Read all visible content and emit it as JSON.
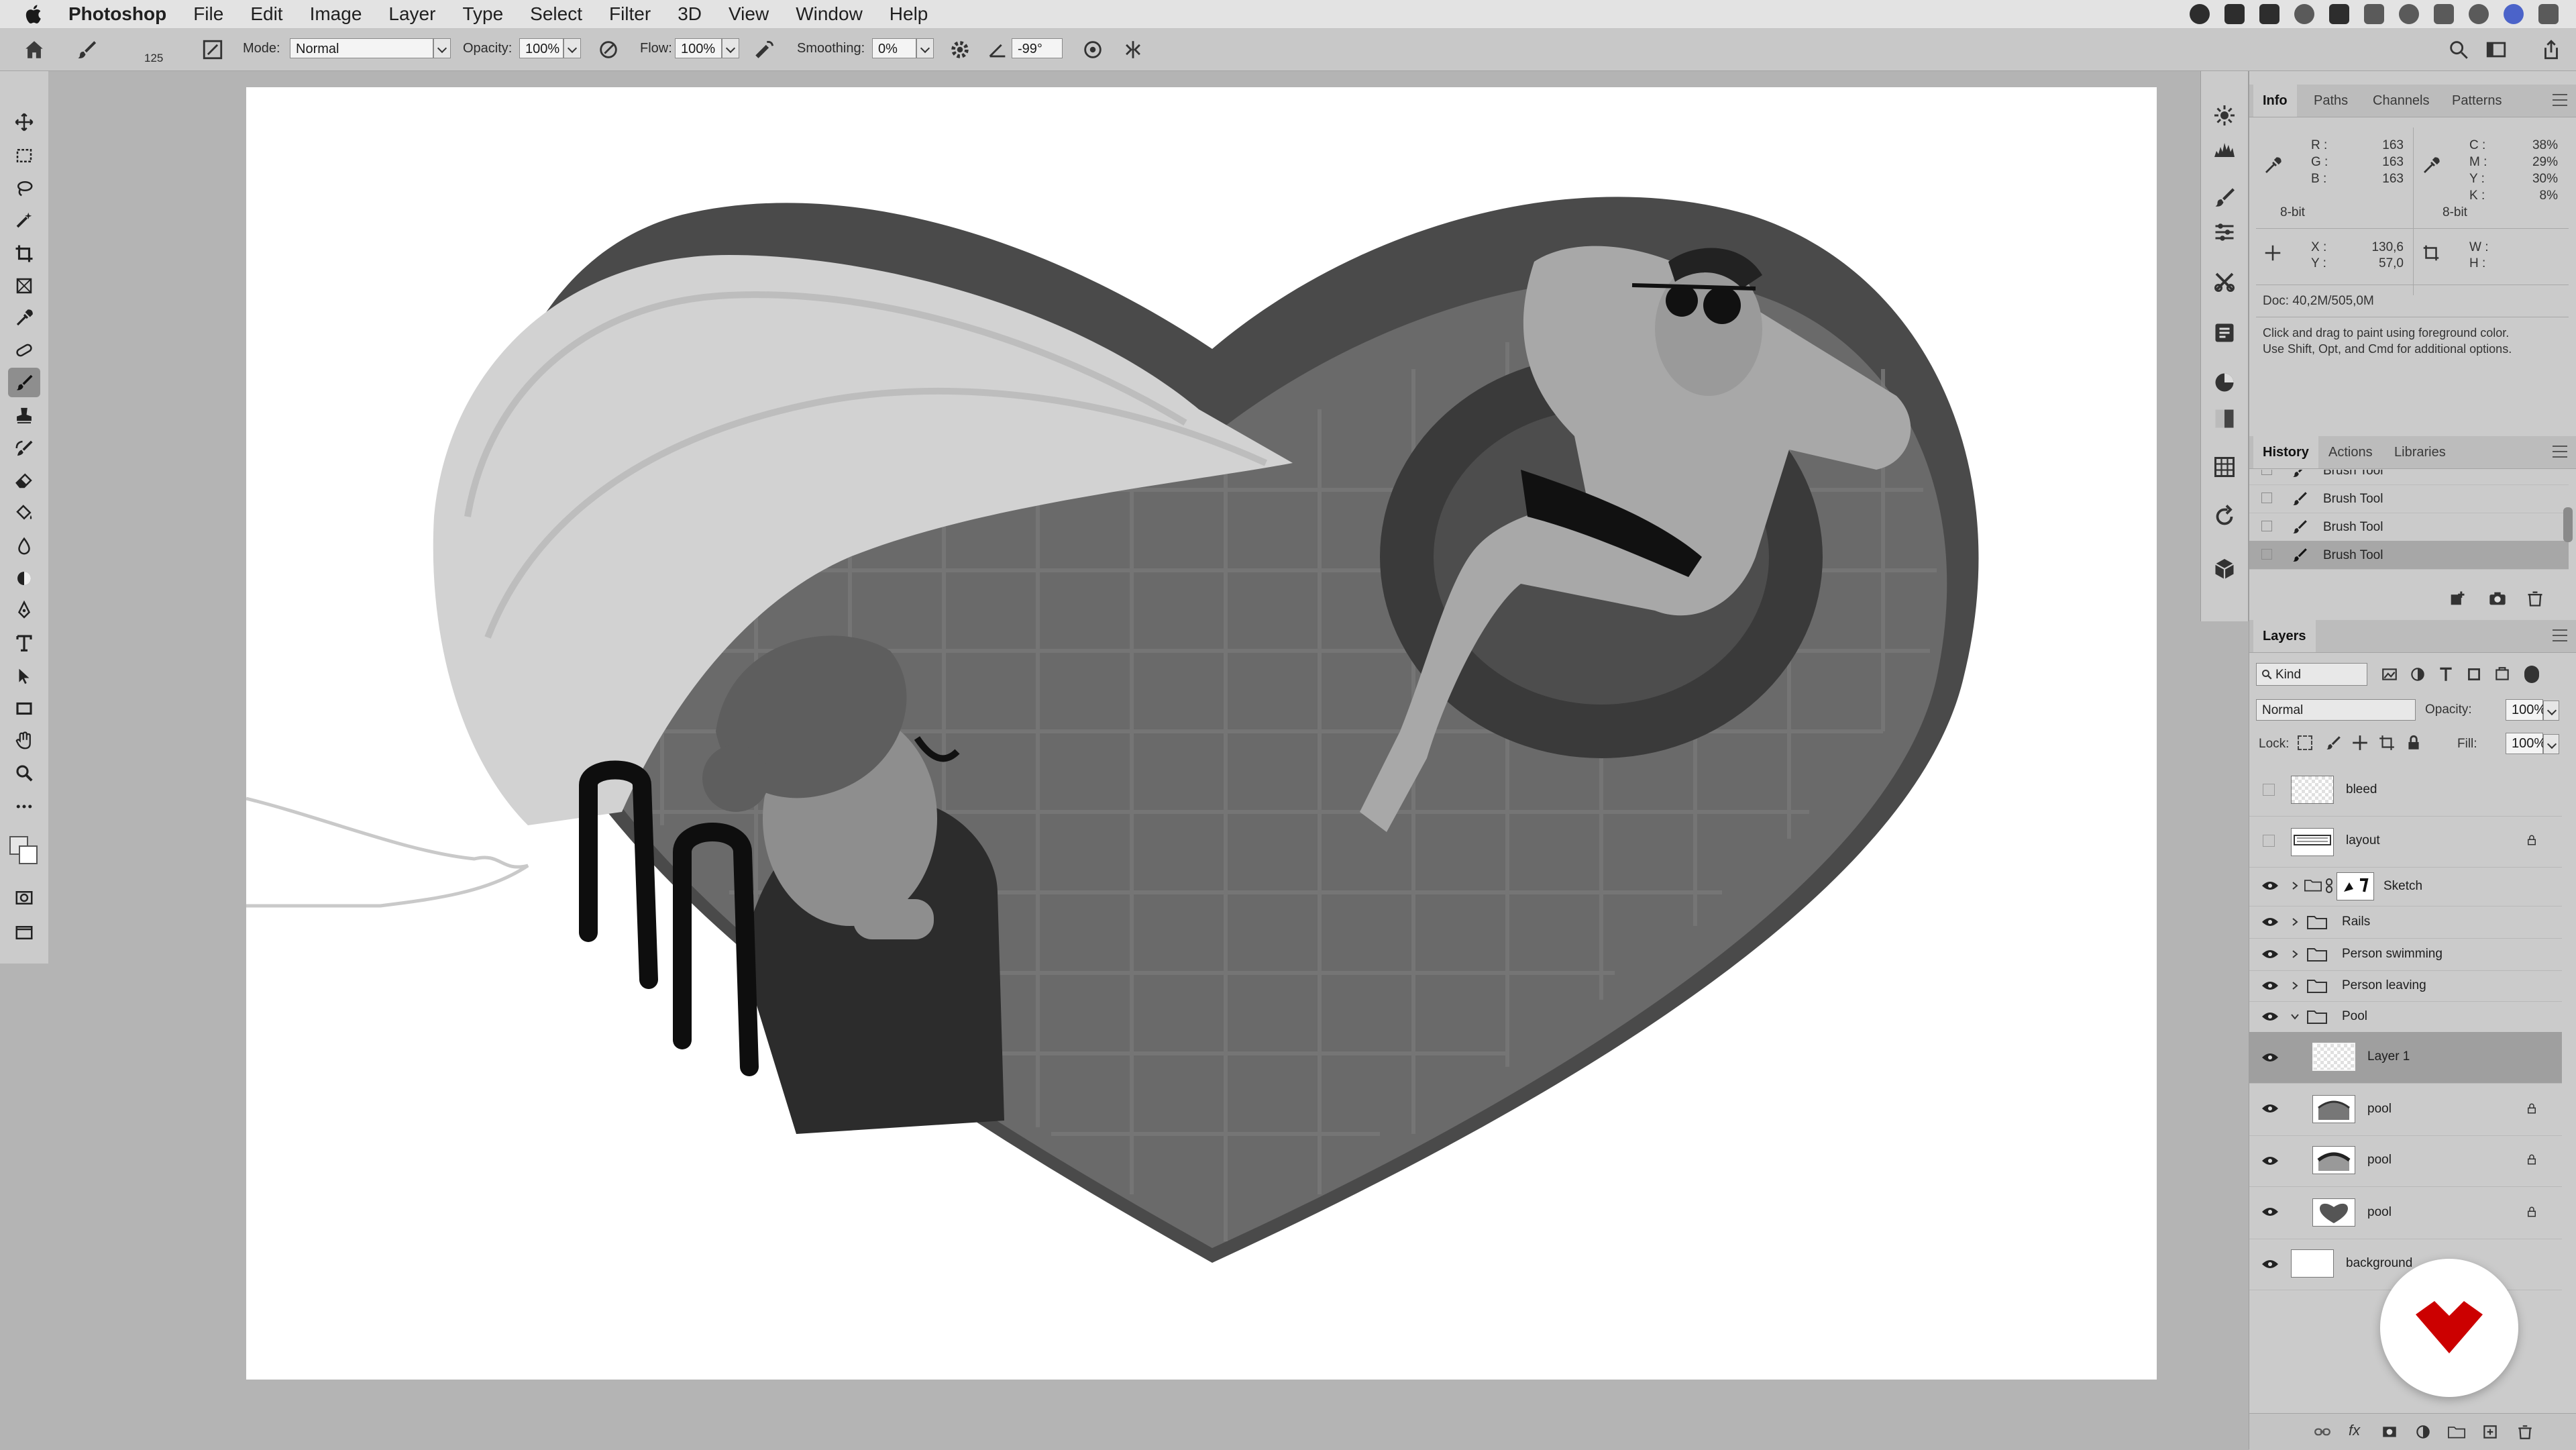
{
  "menubar": {
    "app_name": "Photoshop",
    "items": [
      "File",
      "Edit",
      "Image",
      "Layer",
      "Type",
      "Select",
      "Filter",
      "3D",
      "View",
      "Window",
      "Help"
    ]
  },
  "options_bar": {
    "brush_size": "125",
    "mode_label": "Mode:",
    "mode_value": "Normal",
    "opacity_label": "Opacity:",
    "opacity_value": "100%",
    "flow_label": "Flow:",
    "flow_value": "100%",
    "smoothing_label": "Smoothing:",
    "smoothing_value": "0%",
    "angle_value": "-99°"
  },
  "toolbar": {
    "tools": [
      "move-tool",
      "marquee-tool",
      "lasso-tool",
      "magic-wand-tool",
      "crop-tool",
      "frame-tool",
      "eyedropper-tool",
      "healing-tool",
      "brush-tool",
      "stamp-tool",
      "history-brush-tool",
      "eraser-tool",
      "paint-bucket-tool",
      "smudge-tool",
      "dodge-tool",
      "pen-tool",
      "type-tool",
      "path-selection-tool",
      "rectangle-tool",
      "hand-tool",
      "zoom-tool",
      "more-tools"
    ],
    "active_tool": "brush-tool"
  },
  "info_panel": {
    "tabs": [
      "Info",
      "Paths",
      "Channels",
      "Patterns"
    ],
    "rgb": {
      "r_label": "R :",
      "g_label": "G :",
      "b_label": "B :",
      "r": "163",
      "g": "163",
      "b": "163",
      "depth": "8-bit"
    },
    "cmyk": {
      "c_label": "C :",
      "m_label": "M :",
      "y_label": "Y :",
      "k_label": "K :",
      "c": "38%",
      "m": "29%",
      "y": "30%",
      "k": "8%",
      "depth": "8-bit"
    },
    "xy": {
      "x_label": "X :",
      "y_label": "Y :",
      "x": "130,6",
      "y": "57,0"
    },
    "wh": {
      "w_label": "W :",
      "h_label": "H :"
    },
    "doc": "Doc: 40,2M/505,0M",
    "hint": "Click and drag to paint using foreground color.",
    "hint2": "Use Shift, Opt, and Cmd for additional options."
  },
  "history_panel": {
    "tabs": [
      "History",
      "Actions",
      "Libraries"
    ],
    "items": [
      "Brush Tool",
      "Brush Tool",
      "Brush Tool",
      "Brush Tool"
    ]
  },
  "layers_panel": {
    "title": "Layers",
    "filter_kind": "Kind",
    "blend_mode": "Normal",
    "opacity_label": "Opacity:",
    "opacity": "100%",
    "lock_label": "Lock:",
    "fill_label": "Fill:",
    "fill": "100%",
    "layers": [
      {
        "name": "bleed",
        "visible": false,
        "type": "layer",
        "locked": false
      },
      {
        "name": "layout",
        "visible": false,
        "type": "layer",
        "locked": true
      },
      {
        "name": "Sketch",
        "visible": true,
        "type": "group-masked",
        "locked": false
      },
      {
        "name": "Rails",
        "visible": true,
        "type": "group",
        "locked": false
      },
      {
        "name": "Person swimming",
        "visible": true,
        "type": "group",
        "locked": false
      },
      {
        "name": "Person leaving",
        "visible": true,
        "type": "group",
        "locked": false
      },
      {
        "name": "Pool",
        "visible": true,
        "type": "group-open",
        "locked": false
      },
      {
        "name": "Layer 1",
        "visible": true,
        "type": "layer",
        "locked": false,
        "selected": true
      },
      {
        "name": "pool",
        "visible": true,
        "type": "layer",
        "locked": true
      },
      {
        "name": "pool",
        "visible": true,
        "type": "layer",
        "locked": true
      },
      {
        "name": "pool",
        "visible": true,
        "type": "layer",
        "locked": true
      },
      {
        "name": "background",
        "visible": true,
        "type": "layer",
        "locked": false
      }
    ]
  },
  "colors": {
    "accent_badge": "#cc0000",
    "pool_dark": "#474747",
    "pool_mid": "#6b6b6b",
    "canvas": "#ffffff"
  }
}
